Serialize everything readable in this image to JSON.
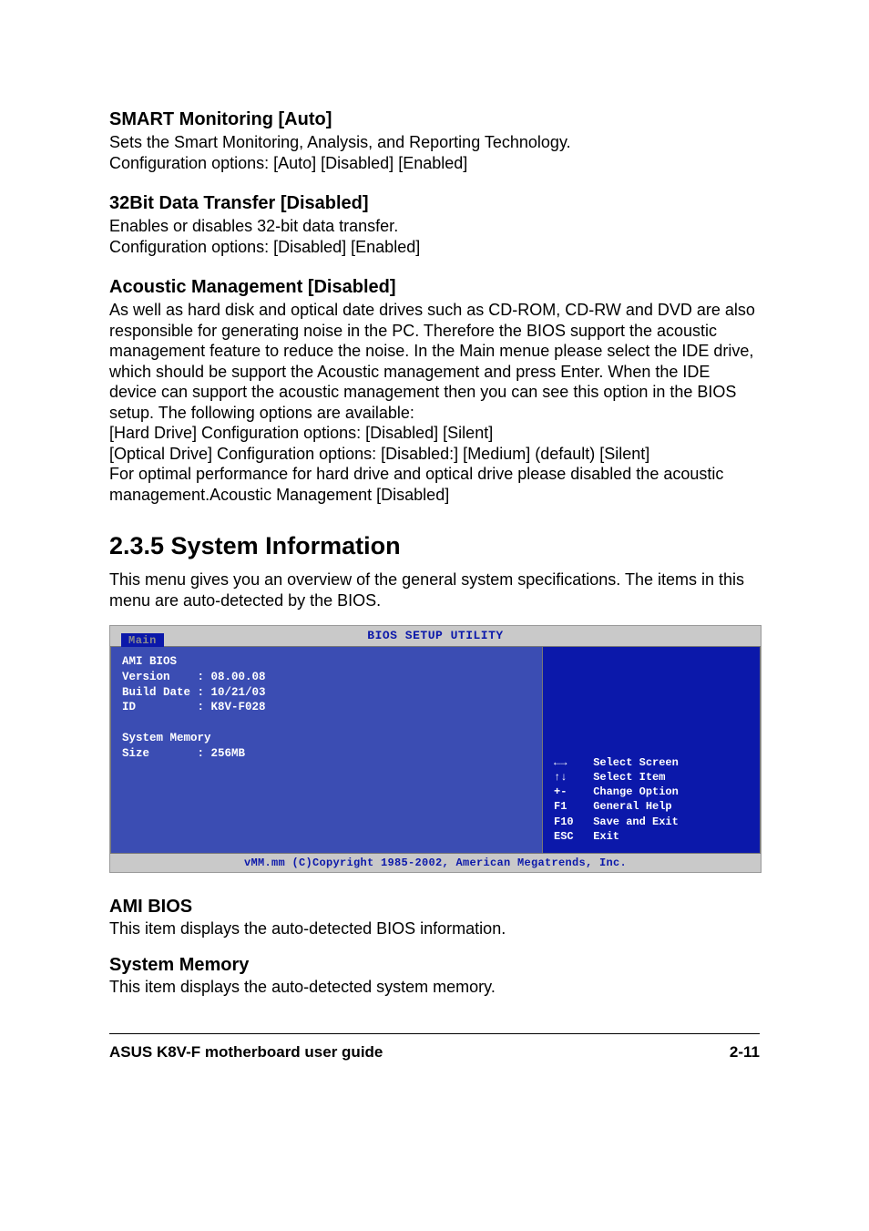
{
  "sections": {
    "smart": {
      "title": "SMART Monitoring [Auto]",
      "desc": "Sets the Smart Monitoring, Analysis, and Reporting Technology.\nConfiguration options: [Auto] [Disabled] [Enabled]"
    },
    "transfer": {
      "title": "32Bit Data Transfer [Disabled]",
      "desc": "Enables or disables 32-bit data transfer.\nConfiguration options: [Disabled] [Enabled]"
    },
    "acoustic": {
      "title": "Acoustic Management [Disabled]",
      "desc": "As well as hard disk and optical date drives such as CD-ROM, CD-RW and DVD are also responsible for generating noise in the PC. Therefore the BIOS support the acoustic management feature to reduce the noise. In the Main menue please select the IDE drive, which should be support the Acoustic management and press Enter. When the IDE device can support the acoustic management then you can see this option in the BIOS setup. The following options are available:\n[Hard Drive]       Configuration options: [Disabled] [Silent]\n[Optical Drive]    Configuration options: [Disabled:] [Medium] (default) [Silent]\nFor optimal performance for hard drive and optical drive please disabled the acoustic management.Acoustic Management [Disabled]"
    },
    "sysinfo": {
      "number_title": "2.3.5    System Information",
      "intro": "This menu gives you an overview of the general system specifications. The items in this menu are auto-detected by the BIOS."
    },
    "amibios": {
      "title": "AMI BIOS",
      "desc": "This item displays the auto-detected BIOS information."
    },
    "sysmem": {
      "title": "System Memory",
      "desc": "This item displays the auto-detected system memory."
    }
  },
  "bios": {
    "header_title": "BIOS SETUP UTILITY",
    "tab": "Main",
    "left_text": "AMI BIOS\nVersion    : 08.00.08\nBuild Date : 10/21/03\nID         : K8V-F028\n\nSystem Memory\nSize       : 256MB",
    "help_text": "←→    Select Screen\n↑↓    Select Item\n+-    Change Option\nF1    General Help\nF10   Save and Exit\nESC   Exit",
    "footer": "vMM.mm (C)Copyright 1985-2002, American Megatrends, Inc."
  },
  "footer": {
    "left": "ASUS K8V-F motherboard user guide",
    "right": "2-11"
  }
}
